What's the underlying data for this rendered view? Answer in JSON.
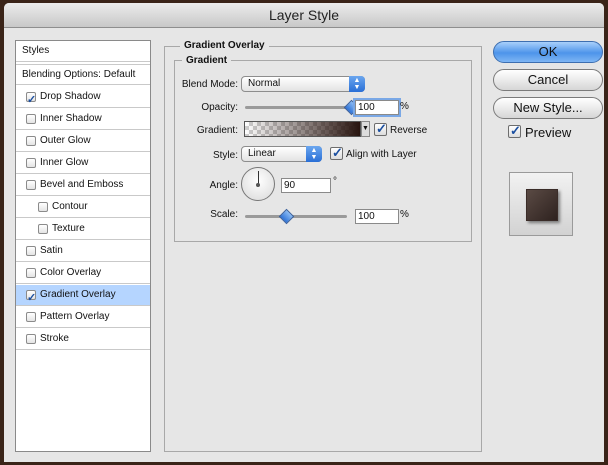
{
  "window": {
    "title": "Layer Style"
  },
  "styles_panel": {
    "header": "Styles",
    "blending": "Blending Options: Default",
    "items": [
      {
        "label": "Drop Shadow",
        "checked": true,
        "indent": false,
        "selected": false
      },
      {
        "label": "Inner Shadow",
        "checked": false,
        "indent": false,
        "selected": false
      },
      {
        "label": "Outer Glow",
        "checked": false,
        "indent": false,
        "selected": false
      },
      {
        "label": "Inner Glow",
        "checked": false,
        "indent": false,
        "selected": false
      },
      {
        "label": "Bevel and Emboss",
        "checked": false,
        "indent": false,
        "selected": false
      },
      {
        "label": "Contour",
        "checked": false,
        "indent": true,
        "selected": false
      },
      {
        "label": "Texture",
        "checked": false,
        "indent": true,
        "selected": false
      },
      {
        "label": "Satin",
        "checked": false,
        "indent": false,
        "selected": false
      },
      {
        "label": "Color Overlay",
        "checked": false,
        "indent": false,
        "selected": false
      },
      {
        "label": "Gradient Overlay",
        "checked": true,
        "indent": false,
        "selected": true
      },
      {
        "label": "Pattern Overlay",
        "checked": false,
        "indent": false,
        "selected": false
      },
      {
        "label": "Stroke",
        "checked": false,
        "indent": false,
        "selected": false
      }
    ]
  },
  "gradient_overlay": {
    "title": "Gradient Overlay",
    "inner_title": "Gradient",
    "blend_mode_label": "Blend Mode:",
    "blend_mode_value": "Normal",
    "opacity_label": "Opacity:",
    "opacity_value": "100",
    "opacity_fraction": 1.0,
    "percent": "%",
    "gradient_label": "Gradient:",
    "reverse_label": "Reverse",
    "reverse_checked": true,
    "style_label": "Style:",
    "style_value": "Linear",
    "align_label": "Align with Layer",
    "align_checked": true,
    "angle_label": "Angle:",
    "angle_value": "90",
    "degree": "°",
    "scale_label": "Scale:",
    "scale_value": "100",
    "scale_fraction": 0.4
  },
  "buttons": {
    "ok": "OK",
    "cancel": "Cancel",
    "new_style": "New Style..."
  },
  "preview": {
    "label": "Preview",
    "checked": true
  },
  "colors": {
    "accent": "#4d94ea",
    "selection": "#b5d5ff",
    "swatch": "#3f302b"
  }
}
